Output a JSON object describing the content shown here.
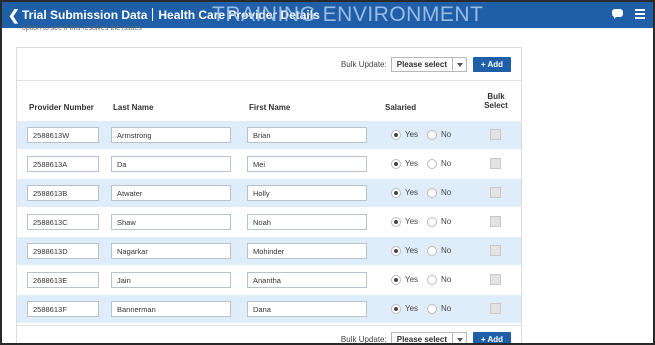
{
  "header": {
    "back_icon": "chevron-left-icon",
    "title_left": "Trial Submission Data",
    "title_right": "Health Care Provider Details",
    "watermark": "TRAINING ENVIRONMENT",
    "chat_icon": "chat-icon",
    "menu_icon": "hamburger-menu-icon"
  },
  "cut_text": "option to see if this resolves the issues",
  "bulk_update": {
    "label": "Bulk Update:",
    "selected": "Please select",
    "add_label": "+ Add"
  },
  "table": {
    "columns": {
      "provider_number": "Provider Number",
      "last_name": "Last Name",
      "first_name": "First Name",
      "salaried": "Salaried",
      "bulk_select_line1": "Bulk",
      "bulk_select_line2": "Select"
    },
    "radio_yes": "Yes",
    "radio_no": "No",
    "rows": [
      {
        "provider_number": "2588613W",
        "last_name": "Armstrong",
        "first_name": "Brian",
        "salaried": "Yes"
      },
      {
        "provider_number": "2588613A",
        "last_name": "Da",
        "first_name": "Mei",
        "salaried": "Yes"
      },
      {
        "provider_number": "2588613B",
        "last_name": "Atwater",
        "first_name": "Holly",
        "salaried": "Yes"
      },
      {
        "provider_number": "2588613C",
        "last_name": "Shaw",
        "first_name": "Noah",
        "salaried": "Yes"
      },
      {
        "provider_number": "2988613D",
        "last_name": "Nagarkar",
        "first_name": "Mohinder",
        "salaried": "Yes"
      },
      {
        "provider_number": "2688613E",
        "last_name": "Jain",
        "first_name": "Anantha",
        "salaried": "Yes"
      },
      {
        "provider_number": "2588613F",
        "last_name": "Bannerman",
        "first_name": "Dana",
        "salaried": "Yes"
      }
    ]
  },
  "colors": {
    "header_bg": "#1f5fa8",
    "row_alt_bg": "#deedf9",
    "add_button_bg": "#1f5fa8"
  }
}
